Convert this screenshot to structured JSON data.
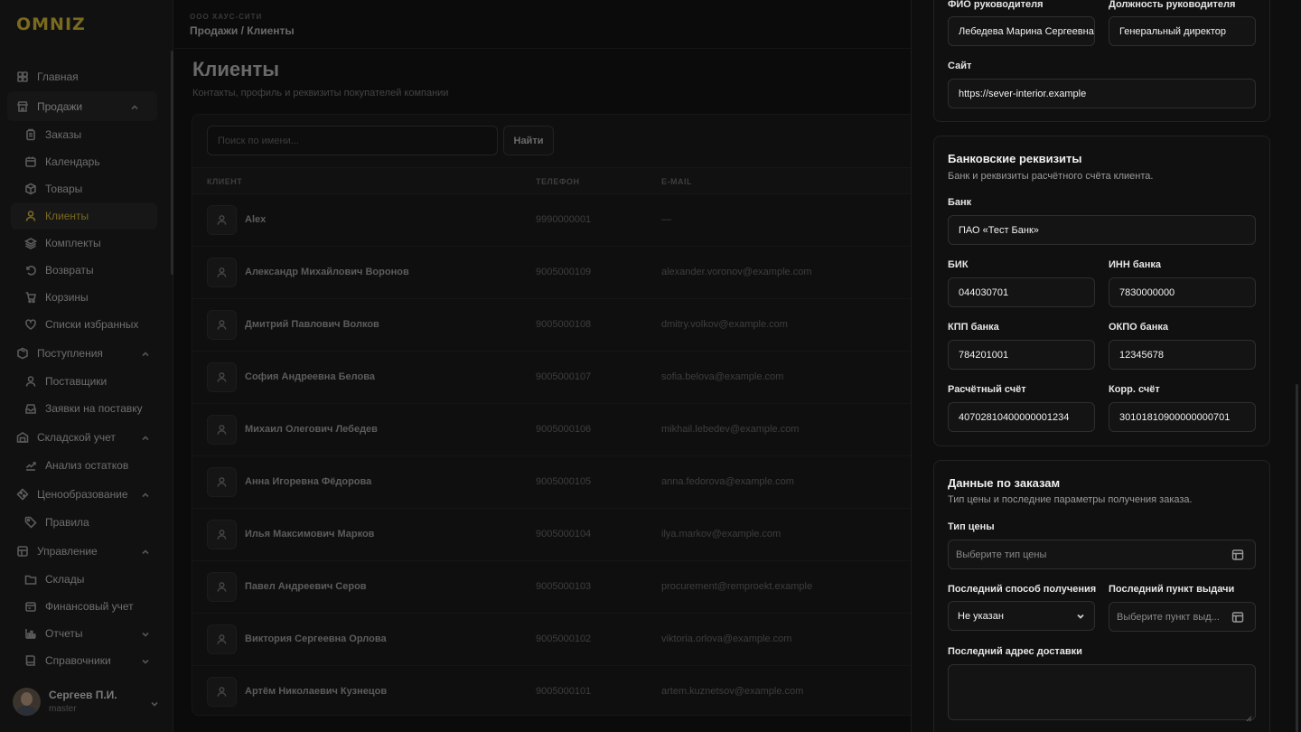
{
  "app": {
    "logo_text": "OMNIZ",
    "accent": "#7a6a1f"
  },
  "sidebar": {
    "items": [
      {
        "label": "Главная",
        "icon": "home-icon",
        "level": "top"
      },
      {
        "label": "Продажи",
        "icon": "store-icon",
        "level": "top",
        "expanded": true
      },
      {
        "label": "Заказы",
        "icon": "clipboard-icon",
        "level": "sub"
      },
      {
        "label": "Календарь",
        "icon": "calendar-icon",
        "level": "sub"
      },
      {
        "label": "Товары",
        "icon": "box-icon",
        "level": "sub"
      },
      {
        "label": "Клиенты",
        "icon": "user-icon",
        "level": "sub",
        "active": true
      },
      {
        "label": "Комплекты",
        "icon": "layers-icon",
        "level": "sub"
      },
      {
        "label": "Возвраты",
        "icon": "undo-icon",
        "level": "sub"
      },
      {
        "label": "Корзины",
        "icon": "cart-icon",
        "level": "sub"
      },
      {
        "label": "Списки избранных",
        "icon": "heart-icon",
        "level": "sub"
      },
      {
        "label": "Поступления",
        "icon": "package-icon",
        "level": "top",
        "expanded": true
      },
      {
        "label": "Поставщики",
        "icon": "user-icon",
        "level": "sub"
      },
      {
        "label": "Заявки на поставку",
        "icon": "inbox-icon",
        "level": "sub"
      },
      {
        "label": "Складской учет",
        "icon": "warehouse-icon",
        "level": "top",
        "expanded": true
      },
      {
        "label": "Анализ остатков",
        "icon": "trend-icon",
        "level": "sub"
      },
      {
        "label": "Ценообразование",
        "icon": "percent-icon",
        "level": "top",
        "expanded": true
      },
      {
        "label": "Правила",
        "icon": "tag-icon",
        "level": "sub"
      },
      {
        "label": "Управление",
        "icon": "grid-icon",
        "level": "top",
        "expanded": true
      },
      {
        "label": "Склады",
        "icon": "folder-icon",
        "level": "sub"
      },
      {
        "label": "Финансовый учет",
        "icon": "wallet-icon",
        "level": "sub"
      },
      {
        "label": "Отчеты",
        "icon": "bar-chart-icon",
        "level": "sub",
        "has_chevron": true
      },
      {
        "label": "Справочники",
        "icon": "book-icon",
        "level": "sub",
        "has_chevron": true
      }
    ],
    "user": {
      "name": "Сергеев П.И.",
      "role": "master"
    }
  },
  "topbar": {
    "company": "ООО ХАУС-СИТИ",
    "breadcrumb": "Продажи / Клиенты"
  },
  "page": {
    "title": "Клиенты",
    "subtitle": "Контакты, профиль и реквизиты покупателей компании"
  },
  "search": {
    "placeholder": "Поиск по имени...",
    "button": "Найти"
  },
  "table": {
    "columns": [
      "КЛИЕНТ",
      "ТЕЛЕФОН",
      "E-MAIL"
    ],
    "rows": [
      {
        "name": "Alex",
        "phone": "9990000001",
        "email": "—"
      },
      {
        "name": "Александр Михайлович Воронов",
        "phone": "9005000109",
        "email": "alexander.voronov@example.com"
      },
      {
        "name": "Дмитрий Павлович Волков",
        "phone": "9005000108",
        "email": "dmitry.volkov@example.com"
      },
      {
        "name": "София Андреевна Белова",
        "phone": "9005000107",
        "email": "sofia.belova@example.com"
      },
      {
        "name": "Михаил Олегович Лебедев",
        "phone": "9005000106",
        "email": "mikhail.lebedev@example.com"
      },
      {
        "name": "Анна Игоревна Фёдорова",
        "phone": "9005000105",
        "email": "anna.fedorova@example.com"
      },
      {
        "name": "Илья Максимович Марков",
        "phone": "9005000104",
        "email": "ilya.markov@example.com"
      },
      {
        "name": "Павел Андреевич Серов",
        "phone": "9005000103",
        "email": "procurement@remproekt.example"
      },
      {
        "name": "Виктория Сергеевна Орлова",
        "phone": "9005000102",
        "email": "viktoria.orlova@example.com"
      },
      {
        "name": "Артём Николаевич Кузнецов",
        "phone": "9005000101",
        "email": "artem.kuznetsov@example.com"
      }
    ]
  },
  "drawer": {
    "company_section": {
      "director_name_label": "ФИО руководителя",
      "director_name_value": "Лебедева Марина Сергеевна",
      "director_position_label": "Должность руководителя",
      "director_position_value": "Генеральный директор",
      "site_label": "Сайт",
      "site_value": "https://sever-interior.example"
    },
    "bank_section": {
      "title": "Банковские реквизиты",
      "description": "Банк и реквизиты расчётного счёта клиента.",
      "bank_label": "Банк",
      "bank_value": "ПАО «Тест Банк»",
      "bik_label": "БИК",
      "bik_value": "044030701",
      "inn_label": "ИНН банка",
      "inn_value": "7830000000",
      "kpp_label": "КПП банка",
      "kpp_value": "784201001",
      "okpo_label": "ОКПО банка",
      "okpo_value": "12345678",
      "account_label": "Расчётный счёт",
      "account_value": "40702810400000001234",
      "corr_label": "Корр. счёт",
      "corr_value": "30101810900000000701"
    },
    "orders_section": {
      "title": "Данные по заказам",
      "description": "Тип цены и последние параметры получения заказа.",
      "price_type_label": "Тип цены",
      "price_type_placeholder": "Выберите тип цены",
      "last_method_label": "Последний способ получения",
      "last_method_value": "Не указан",
      "last_point_label": "Последний пункт выдачи",
      "last_point_placeholder": "Выберите пункт выд...",
      "last_address_label": "Последний адрес доставки"
    }
  }
}
